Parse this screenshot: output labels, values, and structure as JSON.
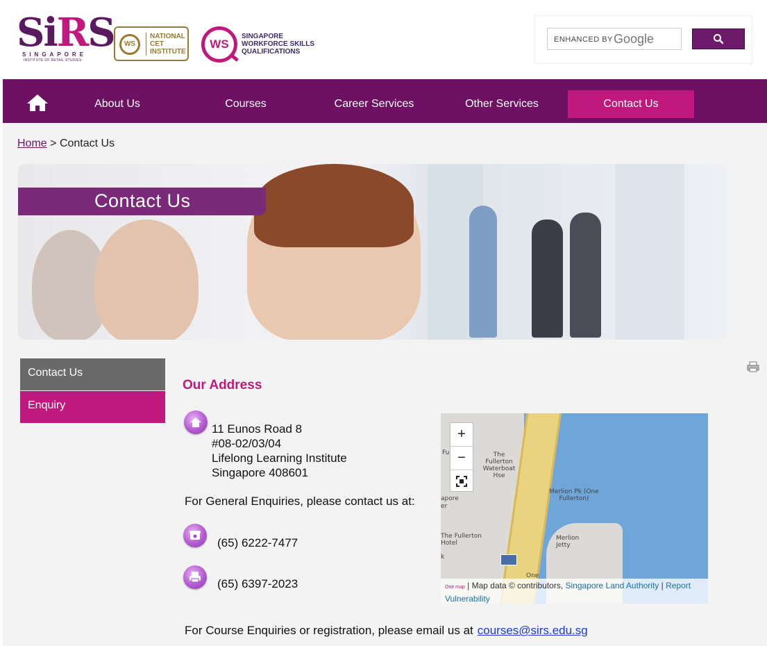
{
  "header": {
    "logo_sirs_main": "SiRS",
    "logo_sirs_sub": "SINGAPORE",
    "logo_sirs_sub2": "INSTITUTE OF RETAIL STUDIES",
    "logo_cet_ws": "WS",
    "logo_cet_text": "NATIONAL CET INSTITUTE",
    "logo_wsq_ws": "WS",
    "logo_wsq_text": "SINGAPORE WORKFORCE SKILLS QUALIFICATIONS",
    "search_enhanced": "ENHANCED BY",
    "search_google": "Google"
  },
  "nav": {
    "items": [
      {
        "label": "About Us"
      },
      {
        "label": "Courses"
      },
      {
        "label": "Career Services"
      },
      {
        "label": "Other Services"
      },
      {
        "label": "Contact Us"
      }
    ]
  },
  "breadcrumb": {
    "home": "Home",
    "separator": ">",
    "current": "Contact Us"
  },
  "banner": {
    "title": "Contact Us"
  },
  "sidebar": {
    "items": [
      {
        "label": "Contact Us"
      },
      {
        "label": "Enquiry"
      }
    ]
  },
  "content": {
    "heading": "Our Address",
    "address": [
      "11 Eunos Road 8",
      "#08-02/03/04",
      "Lifelong Learning Institute",
      "Singapore 408601"
    ],
    "general_enquiries": "For General Enquiries, please contact us at:",
    "phone": "(65) 6222-7477",
    "fax": "(65) 6397-2023",
    "course_enquiries": "For Course Enquiries or registration, please email us at",
    "email": "courses@sirs.edu.sg"
  },
  "map": {
    "labels": {
      "fullerton_waterboat": "The Fullerton Waterboat Hse",
      "merlion_pk": "Merlion Pk (One Fullerton)",
      "fullerton_hotel": "The Fullerton Hotel",
      "merlion_jetty": "Merlion Jetty",
      "one": "One",
      "spore": "apore",
      "er": "er",
      "fu": "Fu",
      "k": "k"
    },
    "zoom_in": "+",
    "zoom_out": "−",
    "attribution_prefix": "| Map data © contributors,",
    "attribution_link": "Singapore Land Authority",
    "attribution_sep": "|",
    "report": "Report",
    "vulnerability": "Vulnerability",
    "onemap": "One map"
  }
}
